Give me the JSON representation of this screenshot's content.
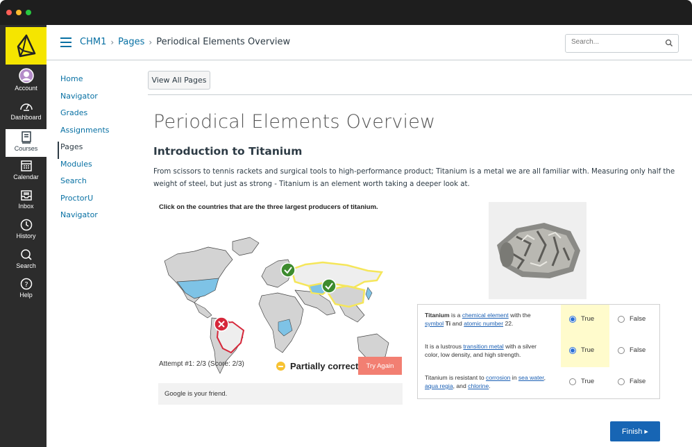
{
  "window": {
    "dots": [
      "#ff5f57",
      "#febc2e",
      "#28c840"
    ]
  },
  "global_nav": {
    "items": [
      {
        "label": "Account",
        "icon": "account-icon"
      },
      {
        "label": "Dashboard",
        "icon": "dashboard-icon"
      },
      {
        "label": "Courses",
        "icon": "courses-icon"
      },
      {
        "label": "Calendar",
        "icon": "calendar-icon"
      },
      {
        "label": "Inbox",
        "icon": "inbox-icon"
      },
      {
        "label": "History",
        "icon": "history-icon"
      },
      {
        "label": "Search",
        "icon": "search-icon"
      },
      {
        "label": "Help",
        "icon": "help-icon"
      }
    ],
    "active": "Courses",
    "brand_color": "#f5e500"
  },
  "header": {
    "breadcrumb": [
      "CHM1",
      "Pages",
      "Periodical Elements Overview"
    ],
    "search_placeholder": "Search..."
  },
  "course_nav": {
    "items": [
      "Home",
      "Navigator",
      "Grades",
      "Assignments",
      "Pages",
      "Modules",
      "Search",
      "ProctorU",
      "Navigator"
    ],
    "active": "Pages"
  },
  "content": {
    "view_all": "View All Pages",
    "title": "Periodical Elements Overview",
    "heading": "Introduction to Titanium",
    "intro": "From scissors to tennis rackets and surgical tools to high-performance product; Titanium is a metal we are all familiar with. Measuring only half the weight of steel, but just as strong - Titanium is an element worth taking a deeper look at."
  },
  "quiz": {
    "question": "Click on the countries that are the three largest producers of titanium.",
    "attempt": "Attempt #1: 2/3   (Score: 2/3)",
    "status": "Partially correct",
    "try_again": "Try Again",
    "hint": "Google is your friend.",
    "finish": "Finish ▸"
  },
  "true_false": [
    {
      "parts": [
        "",
        "Titanium",
        " is a ",
        "chemical element",
        " with the ",
        "symbol",
        " ",
        "Ti",
        " and ",
        "atomic number",
        " 22."
      ],
      "selected": "True"
    },
    {
      "parts": [
        "It is a lustrous ",
        "transition metal",
        " with a silver color, low density, and high strength."
      ],
      "selected": "True"
    },
    {
      "parts": [
        "Titanium is resistant to ",
        "corrosion",
        " in ",
        "sea water",
        ", ",
        "aqua regia",
        ", and ",
        "chlorine",
        "."
      ],
      "selected": null
    }
  ],
  "tf_labels": {
    "true": "True",
    "false": "False"
  }
}
